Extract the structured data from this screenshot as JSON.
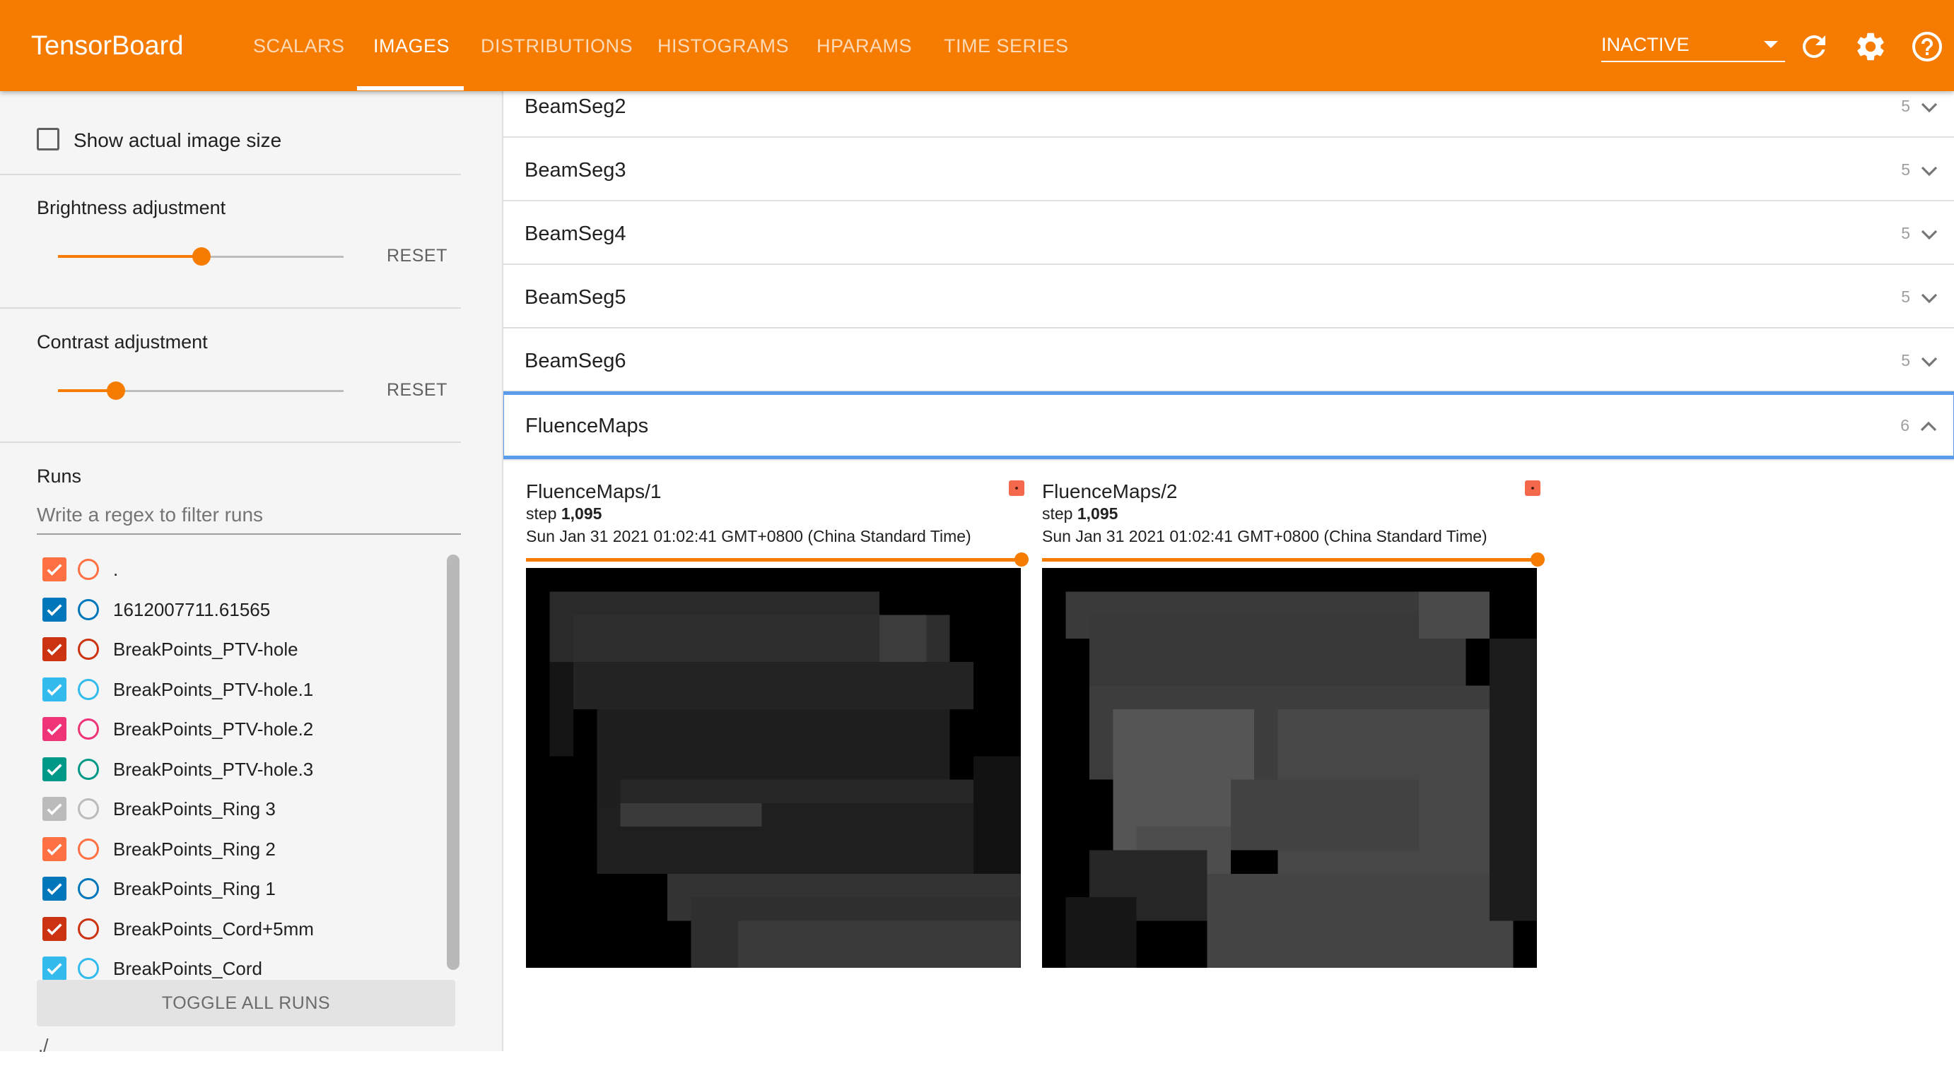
{
  "app": {
    "title": "TensorBoard"
  },
  "nav": {
    "tabs": [
      {
        "label": "SCALARS",
        "active": false
      },
      {
        "label": "IMAGES",
        "active": true
      },
      {
        "label": "DISTRIBUTIONS",
        "active": false
      },
      {
        "label": "HISTOGRAMS",
        "active": false
      },
      {
        "label": "HPARAMS",
        "active": false
      },
      {
        "label": "TIME SERIES",
        "active": false
      }
    ],
    "plugin_select": {
      "value": "INACTIVE"
    },
    "icons": [
      "refresh-icon",
      "gear-icon",
      "help-icon"
    ]
  },
  "sidebar": {
    "show_actual_size": {
      "label": "Show actual image size",
      "checked": false
    },
    "brightness": {
      "label": "Brightness adjustment",
      "reset_label": "RESET",
      "level": 0.5
    },
    "contrast": {
      "label": "Contrast adjustment",
      "reset_label": "RESET",
      "level": 0.2
    },
    "runs": {
      "title": "Runs",
      "filter_placeholder": "Write a regex to filter runs",
      "items": [
        {
          "name": ".",
          "color": "#ff7043",
          "checked": true
        },
        {
          "name": "1612007711.61565",
          "color": "#0077bb",
          "checked": true
        },
        {
          "name": "BreakPoints_PTV-hole",
          "color": "#cc3311",
          "checked": true
        },
        {
          "name": "BreakPoints_PTV-hole.1",
          "color": "#33bbee",
          "checked": true
        },
        {
          "name": "BreakPoints_PTV-hole.2",
          "color": "#ee3377",
          "checked": true
        },
        {
          "name": "BreakPoints_PTV-hole.3",
          "color": "#009988",
          "checked": true
        },
        {
          "name": "BreakPoints_Ring 3",
          "color": "#bbbbbb",
          "checked": true
        },
        {
          "name": "BreakPoints_Ring 2",
          "color": "#ff7043",
          "checked": true
        },
        {
          "name": "BreakPoints_Ring 1",
          "color": "#0077bb",
          "checked": true
        },
        {
          "name": "BreakPoints_Cord+5mm",
          "color": "#cc3311",
          "checked": true
        },
        {
          "name": "BreakPoints_Cord",
          "color": "#33bbee",
          "checked": true
        }
      ],
      "toggle_all_label": "TOGGLE ALL RUNS",
      "footer": "./"
    }
  },
  "main": {
    "categories": [
      {
        "name": "BeamSeg2",
        "count": "5",
        "expanded": false
      },
      {
        "name": "BeamSeg3",
        "count": "5",
        "expanded": false
      },
      {
        "name": "BeamSeg4",
        "count": "5",
        "expanded": false
      },
      {
        "name": "BeamSeg5",
        "count": "5",
        "expanded": false
      },
      {
        "name": "BeamSeg6",
        "count": "5",
        "expanded": false
      },
      {
        "name": "FluenceMaps",
        "count": "6",
        "expanded": true
      }
    ],
    "cards": [
      {
        "title": "FluenceMaps/1",
        "step_label": "step",
        "step_value": "1,095",
        "date": "Sun Jan 31 2021 01:02:41 GMT+0800 (China Standard Time)"
      },
      {
        "title": "FluenceMaps/2",
        "step_label": "step",
        "step_value": "1,095",
        "date": "Sun Jan 31 2021 01:02:41 GMT+0800 (China Standard Time)"
      }
    ]
  },
  "colors": {
    "accent": "#f57c00",
    "focus": "#5b9bec"
  }
}
